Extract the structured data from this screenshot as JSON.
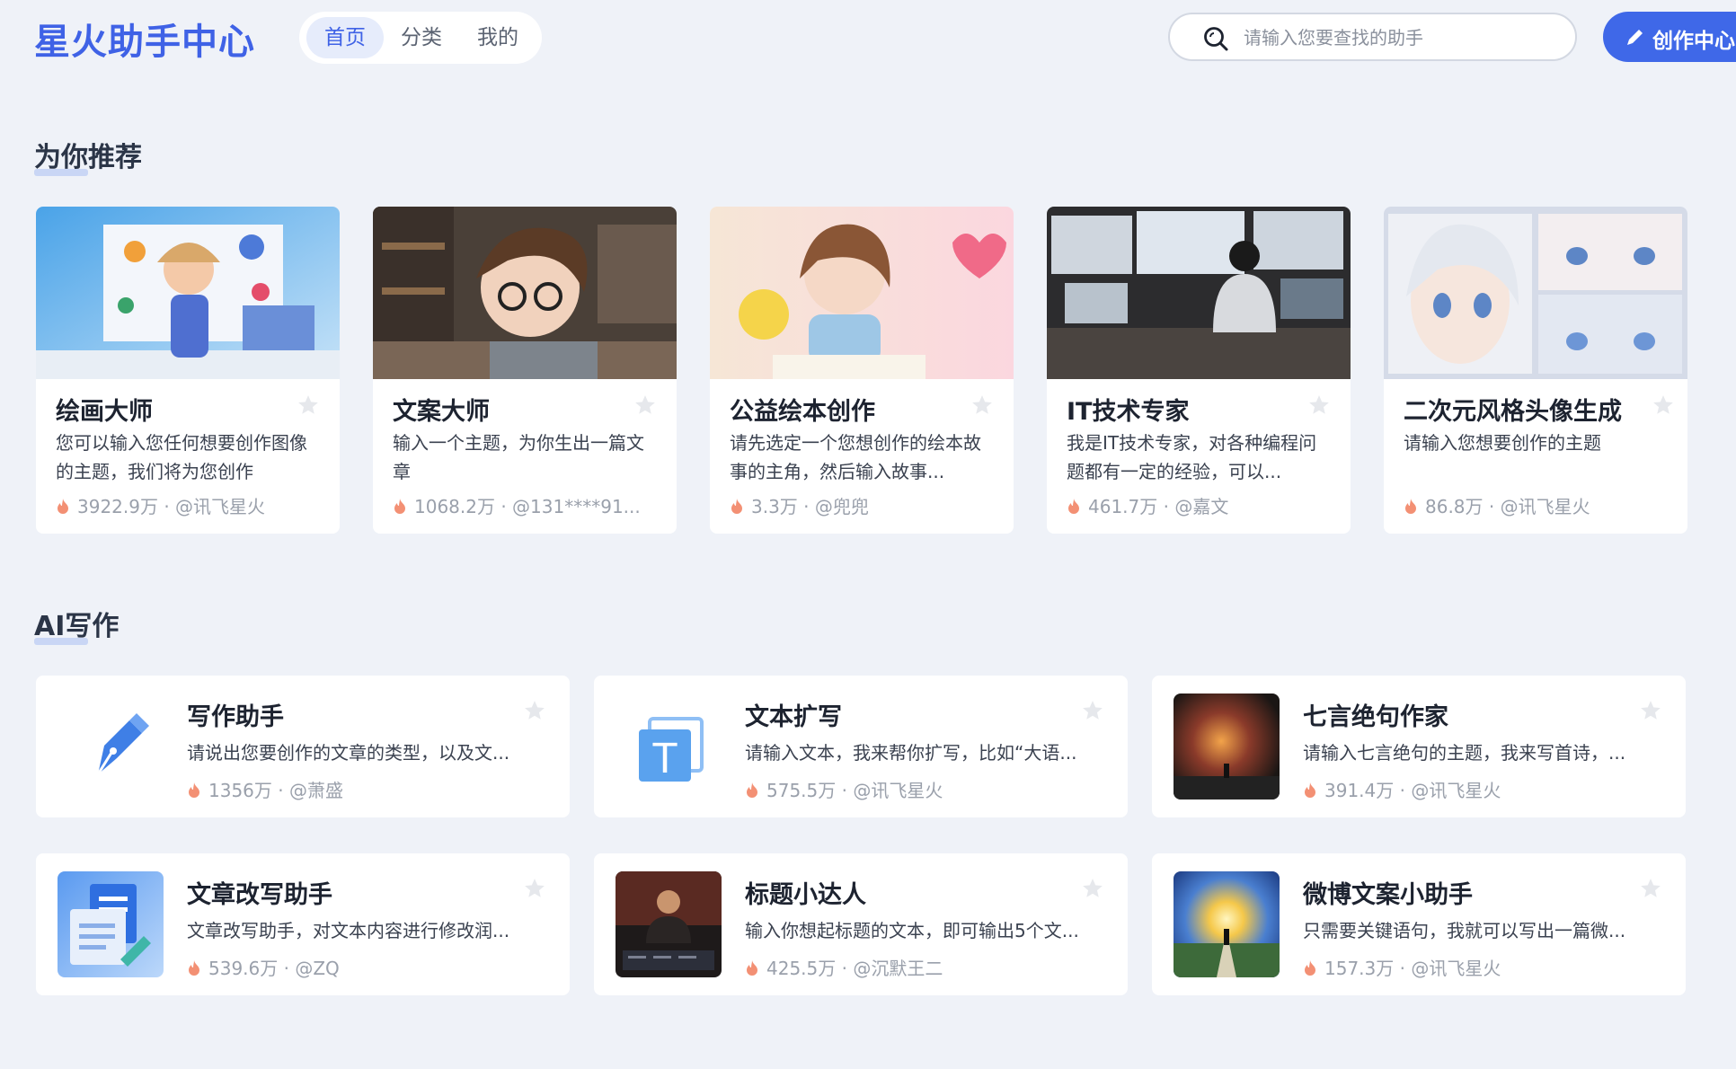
{
  "header": {
    "logo": "星火助手中心",
    "tabs": [
      {
        "label": "首页",
        "active": true
      },
      {
        "label": "分类",
        "active": false
      },
      {
        "label": "我的",
        "active": false
      }
    ],
    "search_placeholder": "请输入您要查找的助手",
    "create_label": "创作中心"
  },
  "recommend": {
    "title": "为你推荐",
    "cards": [
      {
        "title": "绘画大师",
        "desc": "您可以输入您任何想要创作图像的主题，我们将为您创作",
        "meta": "3922.9万 · @讯飞星火",
        "image": "cartoon-girl-painting"
      },
      {
        "title": "文案大师",
        "desc": "输入一个主题，为你生出一篇文章",
        "meta": "1068.2万 · @131****91...",
        "image": "cartoon-boy-writing"
      },
      {
        "title": "公益绘本创作",
        "desc": "请先选定一个您想创作的绘本故事的主角，然后输入故事...",
        "meta": "3.3万 · @兜兜",
        "image": "cartoon-girl-reading"
      },
      {
        "title": "IT技术专家",
        "desc": "我是IT技术专家，对各种编程问题都有一定的经验，可以...",
        "meta": "461.7万 · @嘉文",
        "image": "man-at-monitors"
      },
      {
        "title": "二次元风格头像生成",
        "desc": "请输入您想要创作的主题",
        "meta": "86.8万 · @讯飞星火",
        "image": "anime-girl-faces"
      }
    ]
  },
  "writing": {
    "title": "AI写作",
    "cards": [
      {
        "title": "写作助手",
        "desc": "请说出您要创作的文章的类型，以及文...",
        "meta": "1356万 · @萧盛",
        "icon": "pen-nib-icon"
      },
      {
        "title": "文本扩写",
        "desc": "请输入文本，我来帮你扩写，比如“大语...",
        "meta": "575.5万 · @讯飞星火",
        "icon": "text-t-icon"
      },
      {
        "title": "七言绝句作家",
        "desc": "请输入七言绝句的主题，我来写首诗，...",
        "meta": "391.4万 · @讯飞星火",
        "icon": "stormy-sky-thumb"
      },
      {
        "title": "文章改写助手",
        "desc": "文章改写助手，对文本内容进行修改润...",
        "meta": "539.6万 · @ZQ",
        "icon": "document-edit-icon"
      },
      {
        "title": "标题小达人",
        "desc": "输入你想起标题的文本，即可输出5个文...",
        "meta": "425.5万 · @沉默王二",
        "icon": "speaker-portrait-thumb"
      },
      {
        "title": "微博文案小助手",
        "desc": "只需要关键语句，我就可以写出一篇微...",
        "meta": "157.3万 · @讯飞星火",
        "icon": "sunrise-path-thumb"
      }
    ]
  },
  "colors": {
    "accent": "#3f62e6",
    "background": "#eff2f8",
    "card": "#ffffff",
    "meta": "#9aa0ab",
    "fire": "#f07a5a"
  }
}
